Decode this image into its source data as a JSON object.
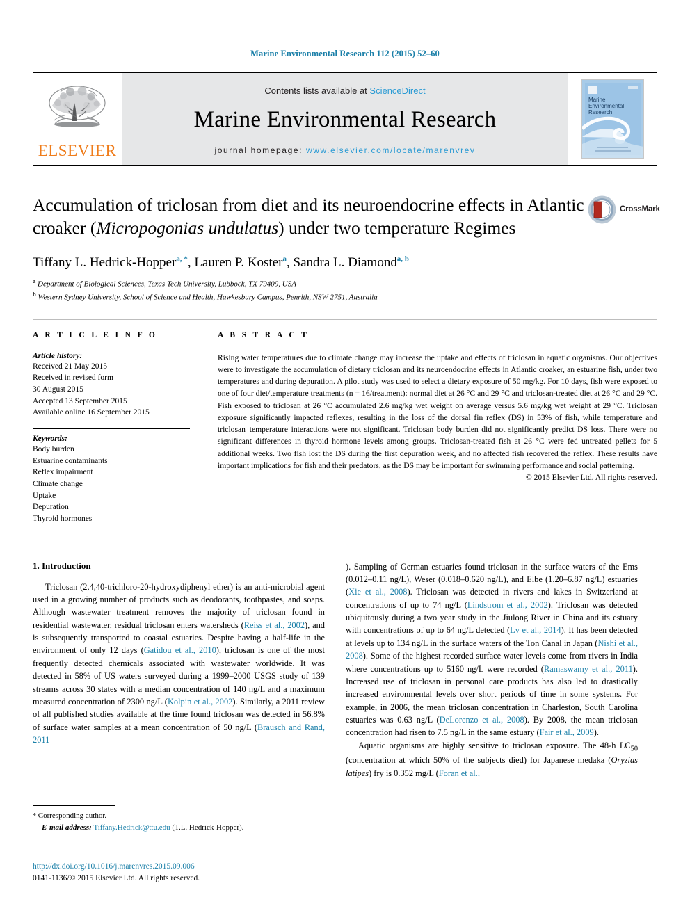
{
  "running_head": "Marine Environmental Research 112 (2015) 52–60",
  "masthead": {
    "publisher_name": "ELSEVIER",
    "contents_prefix": "Contents lists available at ",
    "contents_link": "ScienceDirect",
    "journal_name": "Marine Environmental Research",
    "homepage_prefix": "journal homepage: ",
    "homepage_url": "www.elsevier.com/locate/marenvrev",
    "cover_title_line1": "Marine",
    "cover_title_line2": "Environmental",
    "cover_title_line3": "Research",
    "accent_link_color": "#2b9bd4",
    "publisher_color": "#ef7c1a",
    "band_color": "#e6e7e8"
  },
  "article": {
    "title_part1": "Accumulation of triclosan from diet and its neuroendocrine effects in Atlantic croaker (",
    "title_italic": "Micropogonias undulatus",
    "title_part2": ") under two temperature Regimes",
    "crossmark_label": "CrossMark",
    "authors": [
      {
        "name": "Tiffany L. Hedrick-Hopper",
        "marks": "a, *"
      },
      {
        "name": "Lauren P. Koster",
        "marks": "a"
      },
      {
        "name": "Sandra L. Diamond",
        "marks": "a, b"
      }
    ],
    "affiliations": [
      {
        "mark": "a",
        "text": "Department of Biological Sciences, Texas Tech University, Lubbock, TX 79409, USA"
      },
      {
        "mark": "b",
        "text": "Western Sydney University, School of Science and Health, Hawkesbury Campus, Penrith, NSW 2751, Australia"
      }
    ]
  },
  "article_info": {
    "heading": "A R T I C L E   I N F O",
    "history_heading": "Article history:",
    "history": [
      "Received 21 May 2015",
      "Received in revised form",
      "30 August 2015",
      "Accepted 13 September 2015",
      "Available online 16 September 2015"
    ],
    "keywords_heading": "Keywords:",
    "keywords": [
      "Body burden",
      "Estuarine contaminants",
      "Reflex impairment",
      "Climate change",
      "Uptake",
      "Depuration",
      "Thyroid hormones"
    ]
  },
  "abstract": {
    "heading": "A B S T R A C T",
    "text": "Rising water temperatures due to climate change may increase the uptake and effects of triclosan in aquatic organisms. Our objectives were to investigate the accumulation of dietary triclosan and its neuroendocrine effects in Atlantic croaker, an estuarine fish, under two temperatures and during depuration. A pilot study was used to select a dietary exposure of 50 mg/kg. For 10 days, fish were exposed to one of four diet/temperature treatments (n = 16/treatment): normal diet at 26 °C and 29 °C and triclosan-treated diet at 26 °C and 29 °C. Fish exposed to triclosan at 26 °C accumulated 2.6 mg/kg wet weight on average versus 5.6 mg/kg wet weight at 29 °C. Triclosan exposure significantly impacted reflexes, resulting in the loss of the dorsal fin reflex (DS) in 53% of fish, while temperature and triclosan–temperature interactions were not significant. Triclosan body burden did not significantly predict DS loss. There were no significant differences in thyroid hormone levels among groups. Triclosan-treated fish at 26 °C were fed untreated pellets for 5 additional weeks. Two fish lost the DS during the first depuration week, and no affected fish recovered the reflex. These results have important implications for fish and their predators, as the DS may be important for swimming performance and social patterning.",
    "copyright": "© 2015 Elsevier Ltd. All rights reserved."
  },
  "introduction": {
    "heading": "1.  Introduction",
    "left_paragraph_1_pre": "Triclosan (2,4,40-trichloro-20-hydroxydiphenyl ether) is an anti-microbial agent used in a growing number of products such as deodorants, toothpastes, and soaps. Although wastewater treatment removes the majority of triclosan found in residential wastewater, residual triclosan enters watersheds (",
    "ref_reiss": "Reiss et al., 2002",
    "left_chunk_2": "), and is subsequently transported to coastal estuaries. Despite having a half-life in the environment of only 12 days (",
    "ref_gatidou": "Gatidou et al., 2010",
    "left_chunk_3": "), triclosan is one of the most frequently detected chemicals associated with wastewater worldwide. It was detected in 58% of US waters surveyed during a 1999–2000 USGS study of 139 streams across 30 states with a median concentration of 140 ng/L and a maximum measured concentration of 2300 ng/L (",
    "ref_kolpin": "Kolpin et al., 2002",
    "left_chunk_4": "). Similarly, a 2011 review of all published studies available at the time found triclosan was detected in 56.8% of surface water samples at a mean concentration of 50 ng/L (",
    "ref_brausch": "Brausch and Rand, 2011",
    "right_chunk_1": "). Sampling of German estuaries found triclosan in the surface waters of the Ems (0.012–0.11 ng/L), Weser (0.018–0.620 ng/L), and Elbe (1.20–6.87 ng/L) estuaries (",
    "ref_xie": "Xie et al., 2008",
    "right_chunk_2": "). Triclosan was detected in rivers and lakes in Switzerland at concentrations of up to 74 ng/L (",
    "ref_lindstrom": "Lindstrom et al., 2002",
    "right_chunk_3": "). Triclosan was detected ubiquitously during a two year study in the Jiulong River in China and its estuary with concentrations of up to 64 ng/L detected (",
    "ref_lv": "Lv et al., 2014",
    "right_chunk_4": "). It has been detected at levels up to 134 ng/L in the surface waters of the Ton Canal in Japan (",
    "ref_nishi": "Nishi et al., 2008",
    "right_chunk_5": "). Some of the highest recorded surface water levels come from rivers in India where concentrations up to 5160 ng/L were recorded (",
    "ref_ramaswamy": "Ramaswamy et al., 2011",
    "right_chunk_6": "). Increased use of triclosan in personal care products has also led to drastically increased environmental levels over short periods of time in some systems. For example, in 2006, the mean triclosan concentration in Charleston, South Carolina estuaries was 0.63 ng/L (",
    "ref_delorenzo": "DeLorenzo et al., 2008",
    "right_chunk_7": "). By 2008, the mean triclosan concentration had risen to 7.5 ng/L in the same estuary (",
    "ref_fair": "Fair et al., 2009",
    "right_chunk_8": ").",
    "para2_pre": "Aquatic organisms are highly sensitive to triclosan exposure. The 48-h LC",
    "para2_sub": "50",
    "para2_mid": " (concentration at which 50% of the subjects died) for Japanese medaka (",
    "para2_italic": "Oryzias latipes",
    "para2_post": ") fry is 0.352 mg/L (",
    "ref_foran": "Foran et al.,"
  },
  "footer": {
    "corresponding_marker": "*",
    "corresponding_label": " Corresponding author.",
    "email_label": "E-mail address:",
    "email": "Tiffany.Hedrick@ttu.edu",
    "email_suffix": " (T.L. Hedrick-Hopper).",
    "doi": "http://dx.doi.org/10.1016/j.marenvres.2015.09.006",
    "issn": "0141-1136/© 2015 Elsevier Ltd. All rights reserved."
  }
}
